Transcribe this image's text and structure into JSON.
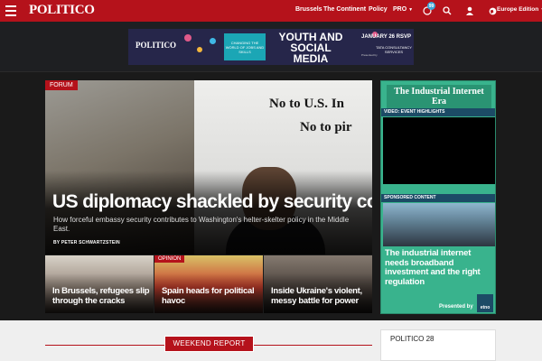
{
  "nav": {
    "logo": "POLITICO",
    "links": [
      "Brussels",
      "The Continent",
      "Policy",
      "PRO"
    ],
    "notification_count": "99",
    "edition": "Europe Edition",
    "icons": [
      "menu-icon",
      "notification-icon",
      "search-icon",
      "user-icon",
      "globe-icon"
    ]
  },
  "ad": {
    "logo": "POLITICO",
    "subtitle": "CHANGING THE WORLD OF JOBS AND SKILLS",
    "headline_1": "YOUTH AND",
    "headline_2": "SOCIAL",
    "headline_3": "MEDIA",
    "date": "JANUARY 26 RSVP",
    "sponsor": "TATA CONSULTANCY SERVICES",
    "presented": "Presented by"
  },
  "hero": {
    "tag": "FORUM",
    "title": "US diplomacy shackled by security concerns",
    "subtitle": "How forceful embassy security contributes to Washington's helter-skelter policy in the Middle East.",
    "byline": "BY PETER SCHWARTZSTEIN",
    "poster_line1": "No to U.S. In",
    "poster_line2": "No to pir"
  },
  "thumbs": [
    {
      "title": "In Brussels, refugees slip through the cracks",
      "tag": ""
    },
    {
      "title": "Spain heads for political havoc",
      "tag": "OPINION"
    },
    {
      "title": "Inside Ukraine's violent, messy battle for power",
      "tag": ""
    }
  ],
  "sidebar": {
    "title": "The Industrial Internet Era",
    "video_label": "VIDEO: EVENT HIGHLIGHTS",
    "sponsored_label": "SPONSORED CONTENT",
    "sponsored_title": "The industrial internet needs broadband investment and the right regulation",
    "presented_by": "Presented by",
    "sponsor_logo": "etno"
  },
  "lower": {
    "section": "WEEKEND REPORT",
    "widget": "POLITICO 28"
  },
  "colors": {
    "brand": "#b5121b",
    "sidebar": "#39b38d",
    "label": "#1c4b66"
  }
}
